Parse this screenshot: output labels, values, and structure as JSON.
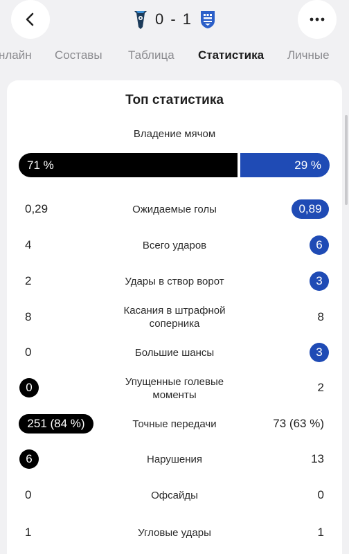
{
  "header": {
    "score": "0 - 1"
  },
  "tabs": [
    {
      "label": "нлайн"
    },
    {
      "label": "Составы"
    },
    {
      "label": "Таблица"
    },
    {
      "label": "Статистика"
    },
    {
      "label": "Личные"
    }
  ],
  "card": {
    "title": "Топ статистика",
    "possession": {
      "label": "Владение мячом",
      "home": "71 %",
      "away": "29 %",
      "home_share": 0.71
    }
  },
  "stats": [
    {
      "label": "Ожидаемые голы",
      "home": "0,29",
      "away": "0,89",
      "highlight": "away"
    },
    {
      "label": "Всего ударов",
      "home": "4",
      "away": "6",
      "highlight": "away"
    },
    {
      "label": "Удары в створ ворот",
      "home": "2",
      "away": "3",
      "highlight": "away"
    },
    {
      "label": "Касания в штрафной соперника",
      "home": "8",
      "away": "8",
      "highlight": "none"
    },
    {
      "label": "Большие шансы",
      "home": "0",
      "away": "3",
      "highlight": "away"
    },
    {
      "label": "Упущенные голевые моменты",
      "home": "0",
      "away": "2",
      "highlight": "home"
    },
    {
      "label": "Точные передачи",
      "home": "251 (84 %)",
      "away": "73 (63 %)",
      "highlight": "home"
    },
    {
      "label": "Нарушения",
      "home": "6",
      "away": "13",
      "highlight": "home"
    },
    {
      "label": "Офсайды",
      "home": "0",
      "away": "0",
      "highlight": "none"
    },
    {
      "label": "Угловые удары",
      "home": "1",
      "away": "1",
      "highlight": "none"
    }
  ],
  "colors": {
    "home": "#000000",
    "away": "#1f4bb5"
  },
  "icons": {
    "back": "chevron-left-icon",
    "more": "more-horizontal-icon",
    "home_crest": "home-team-crest-icon",
    "away_crest": "away-team-crest-icon"
  }
}
